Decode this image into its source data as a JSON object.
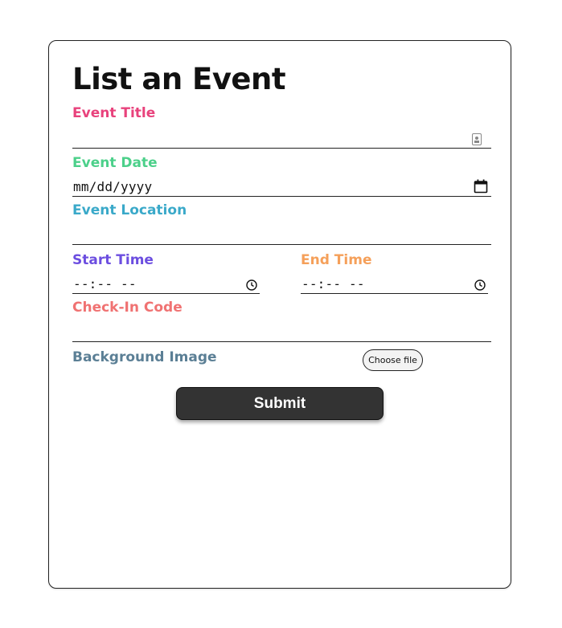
{
  "form": {
    "title": "List an Event",
    "event_title": {
      "label": "Event Title",
      "value": ""
    },
    "event_date": {
      "label": "Event Date",
      "value": "mm/dd/yyyy"
    },
    "event_location": {
      "label": "Event Location",
      "value": ""
    },
    "start_time": {
      "label": "Start Time",
      "value": "--:-- --"
    },
    "end_time": {
      "label": "End Time",
      "value": "--:-- --"
    },
    "check_in_code": {
      "label": "Check-In Code",
      "value": ""
    },
    "background_image": {
      "label": "Background Image",
      "button": "Choose file"
    },
    "submit_label": "Submit"
  },
  "colors": {
    "event_title": "#e8427c",
    "event_date": "#4cd08a",
    "event_location": "#3aa9c9",
    "start_time": "#6c4ee0",
    "end_time": "#f5a05a",
    "check_in_code": "#f07272",
    "background_image": "#5b7f95",
    "submit_bg": "#333333"
  },
  "icons": {
    "event_title": "contact-card-icon",
    "event_date": "calendar-icon",
    "start_time": "clock-icon",
    "end_time": "clock-icon"
  }
}
